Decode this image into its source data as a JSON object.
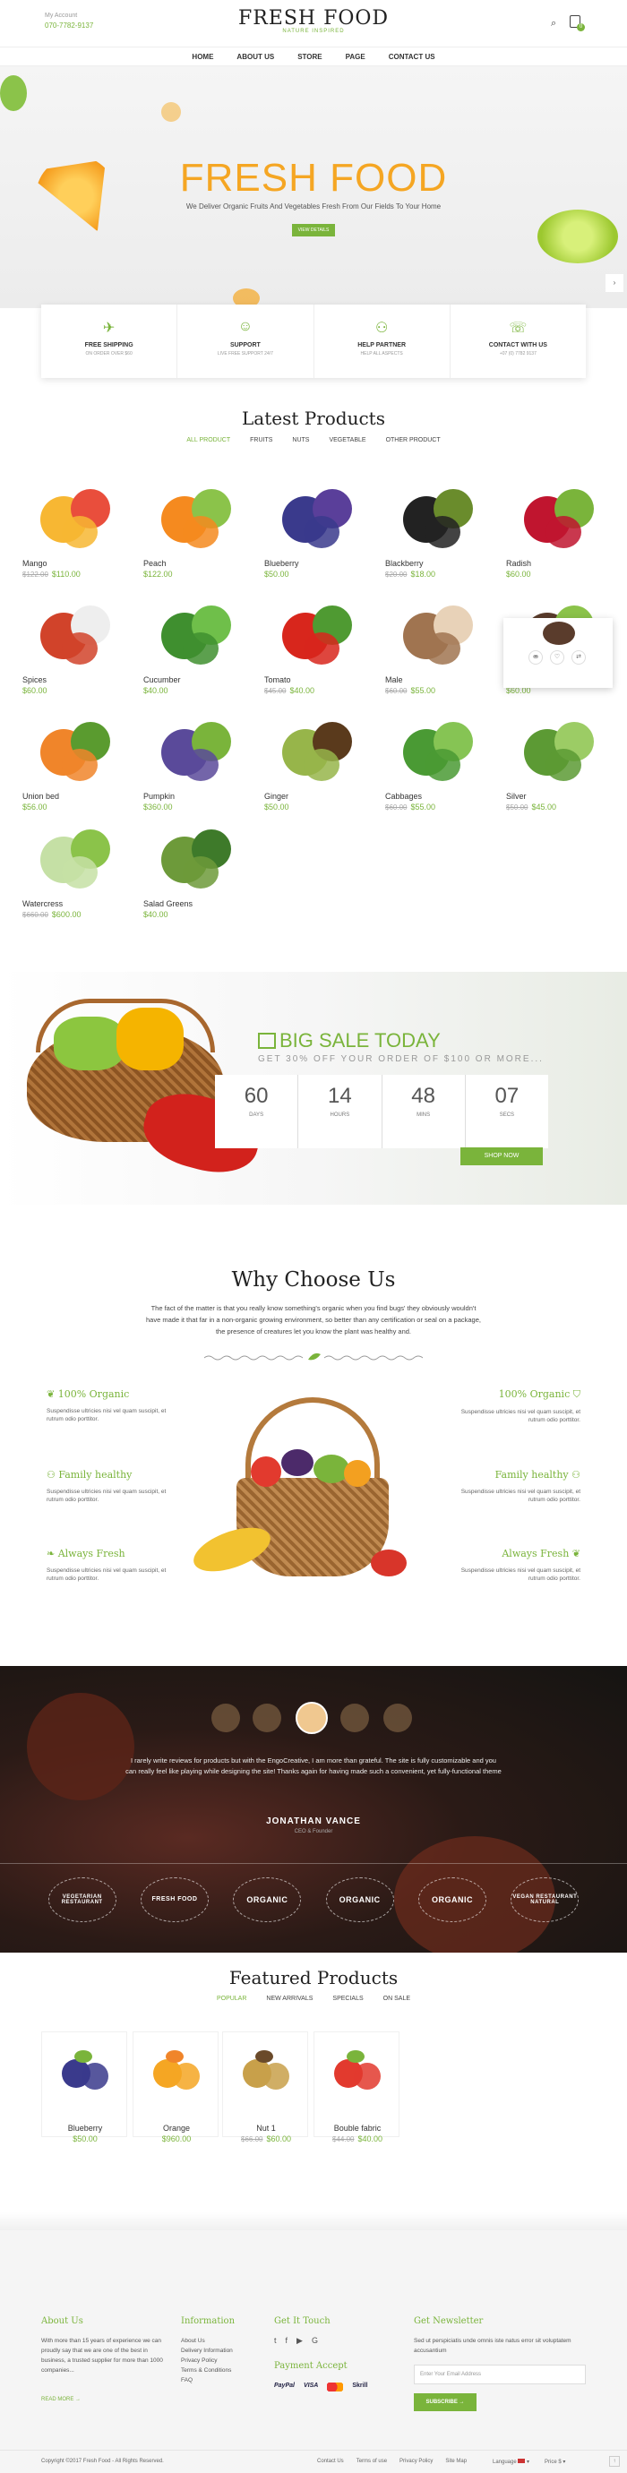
{
  "header": {
    "account": "My Account",
    "phone": "070-7782-9137",
    "logo": "FRESH FOOD",
    "tagline": "NATURE INSPIRED",
    "cart_count": "0"
  },
  "nav": [
    "HOME",
    "ABOUT US",
    "STORE",
    "PAGE",
    "CONTACT US"
  ],
  "hero": {
    "title": "FRESH FOOD",
    "subtitle": "We Deliver Organic Fruits And Vegetables Fresh From Our Fields To Your Home",
    "button": "VIEW DETAILS"
  },
  "features": [
    {
      "title": "FREE SHIPPING",
      "sub": "ON ORDER OVER $60"
    },
    {
      "title": "SUPPORT",
      "sub": "LIVE FREE SUPPORT 24/7"
    },
    {
      "title": "HELP PARTNER",
      "sub": "HELP ALL ASPECTS"
    },
    {
      "title": "CONTACT WITH US",
      "sub": "+07 (0) 7782 9137"
    }
  ],
  "latest": {
    "title": "Latest Products",
    "tabs": [
      "ALL PRODUCT",
      "FRUITS",
      "NUTS",
      "VEGETABLE",
      "OTHER PRODUCT"
    ],
    "products": [
      {
        "name": "Mango",
        "old": "$122.00",
        "price": "$110.00"
      },
      {
        "name": "Peach",
        "old": "",
        "price": "$122.00"
      },
      {
        "name": "Blueberry",
        "old": "",
        "price": "$50.00"
      },
      {
        "name": "Blackberry",
        "old": "$20.00",
        "price": "$18.00"
      },
      {
        "name": "Radish",
        "old": "",
        "price": "$60.00"
      },
      {
        "name": "Spices",
        "old": "",
        "price": "$60.00"
      },
      {
        "name": "Cucumber",
        "old": "",
        "price": "$40.00"
      },
      {
        "name": "Tomato",
        "old": "$45.00",
        "price": "$40.00"
      },
      {
        "name": "Male",
        "old": "$60.00",
        "price": "$55.00"
      },
      {
        "name": "",
        "old": "",
        "price": "$60.00"
      },
      {
        "name": "Union bed",
        "old": "",
        "price": "$56.00"
      },
      {
        "name": "Pumpkin",
        "old": "",
        "price": "$360.00"
      },
      {
        "name": "Ginger",
        "old": "",
        "price": "$50.00"
      },
      {
        "name": "Cabbages",
        "old": "$60.00",
        "price": "$55.00"
      },
      {
        "name": "Silver",
        "old": "$50.00",
        "price": "$45.00"
      },
      {
        "name": "Watercress",
        "old": "$660.00",
        "price": "$600.00"
      },
      {
        "name": "Salad Greens",
        "old": "",
        "price": "$40.00"
      }
    ]
  },
  "sale": {
    "title": "BIG SALE TODAY",
    "sub": "GET 30% OFF YOUR ORDER OF $100 OR MORE...",
    "countdown": [
      {
        "n": "60",
        "l": "DAYS"
      },
      {
        "n": "14",
        "l": "HOURS"
      },
      {
        "n": "48",
        "l": "MINS"
      },
      {
        "n": "07",
        "l": "SECS"
      }
    ],
    "button": "SHOP NOW"
  },
  "why": {
    "title": "Why Choose Us",
    "desc": "The fact of the matter is that you really know something's organic when you find bugs' they obviously wouldn't have made it that far in a non-organic growing environment, so better than any certification or seal on a package, the presence of creatures let you know the plant was healthy and.",
    "items": [
      {
        "title": "100% Organic",
        "desc": "Suspendisse ultricies nisi vel quam suscipit, et rutrum odio porttitor."
      },
      {
        "title": "Family healthy",
        "desc": "Suspendisse ultricies nisi vel quam suscipit, et rutrum odio porttitor."
      },
      {
        "title": "Always Fresh",
        "desc": "Suspendisse ultricies nisi vel quam suscipit, et rutrum odio porttitor."
      },
      {
        "title": "100% Organic",
        "desc": "Suspendisse ultricies nisi vel quam suscipit, et rutrum odio porttitor."
      },
      {
        "title": "Family healthy",
        "desc": "Suspendisse ultricies nisi vel quam suscipit, et rutrum odio porttitor."
      },
      {
        "title": "Always Fresh",
        "desc": "Suspendisse ultricies nisi vel quam suscipit, et rutrum odio porttitor."
      }
    ]
  },
  "testimonial": {
    "text": "I rarely write reviews for products but with the EngoCreative, I am more than grateful. The site is fully customizable and you can really feel like playing while designing the site! Thanks again for having made such a convenient, yet fully-functional theme",
    "name": "JONATHAN VANCE",
    "role": "CEO & Founder",
    "brands": [
      "VEGETARIAN RESTAURANT",
      "FRESH FOOD",
      "ORGANIC",
      "ORGANIC",
      "ORGANIC",
      "VEGAN RESTAURANT NATURAL"
    ]
  },
  "featured": {
    "title": "Featured Products",
    "tabs": [
      "POPULAR",
      "NEW ARRIVALS",
      "SPECIALS",
      "ON SALE"
    ],
    "products": [
      {
        "name": "Blueberry",
        "old": "",
        "price": "$50.00"
      },
      {
        "name": "Orange",
        "old": "",
        "price": "$960.00"
      },
      {
        "name": "Nut 1",
        "old": "$66.00",
        "price": "$60.00"
      },
      {
        "name": "Bouble fabric",
        "old": "$44.00",
        "price": "$40.00"
      }
    ]
  },
  "footer": {
    "about_title": "About Us",
    "about_text": "With more than 15 years of experience we can proudly say that we are one of the best in business, a trusted supplier for more than 1000 companies...",
    "read_more": "READ MORE →",
    "info_title": "Information",
    "info_links": [
      "About Us",
      "Delivery Information",
      "Privacy Policy",
      "Terms & Conditions",
      "FAQ"
    ],
    "touch_title": "Get It Touch",
    "payment_title": "Payment Accept",
    "payments": [
      "PayPal",
      "VISA",
      "",
      "Skrill"
    ],
    "news_title": "Get Newsletter",
    "news_text": "Sed ut perspiciatis unde omnis iste natus error sit voluptatem accusantium",
    "email_placeholder": "Enter Your Email Address",
    "subscribe": "SUBSCRIBE →",
    "copyright": "Copyright ©2017 Fresh Food - All Rights Reserved.",
    "bottom_links": [
      "Contact Us",
      "Terms of use",
      "Privacy Policy",
      "Site Map"
    ],
    "language": "Language",
    "price": "Price"
  },
  "colors": {
    "accent": "#7ab43b",
    "hero_title": "#f5a623"
  }
}
